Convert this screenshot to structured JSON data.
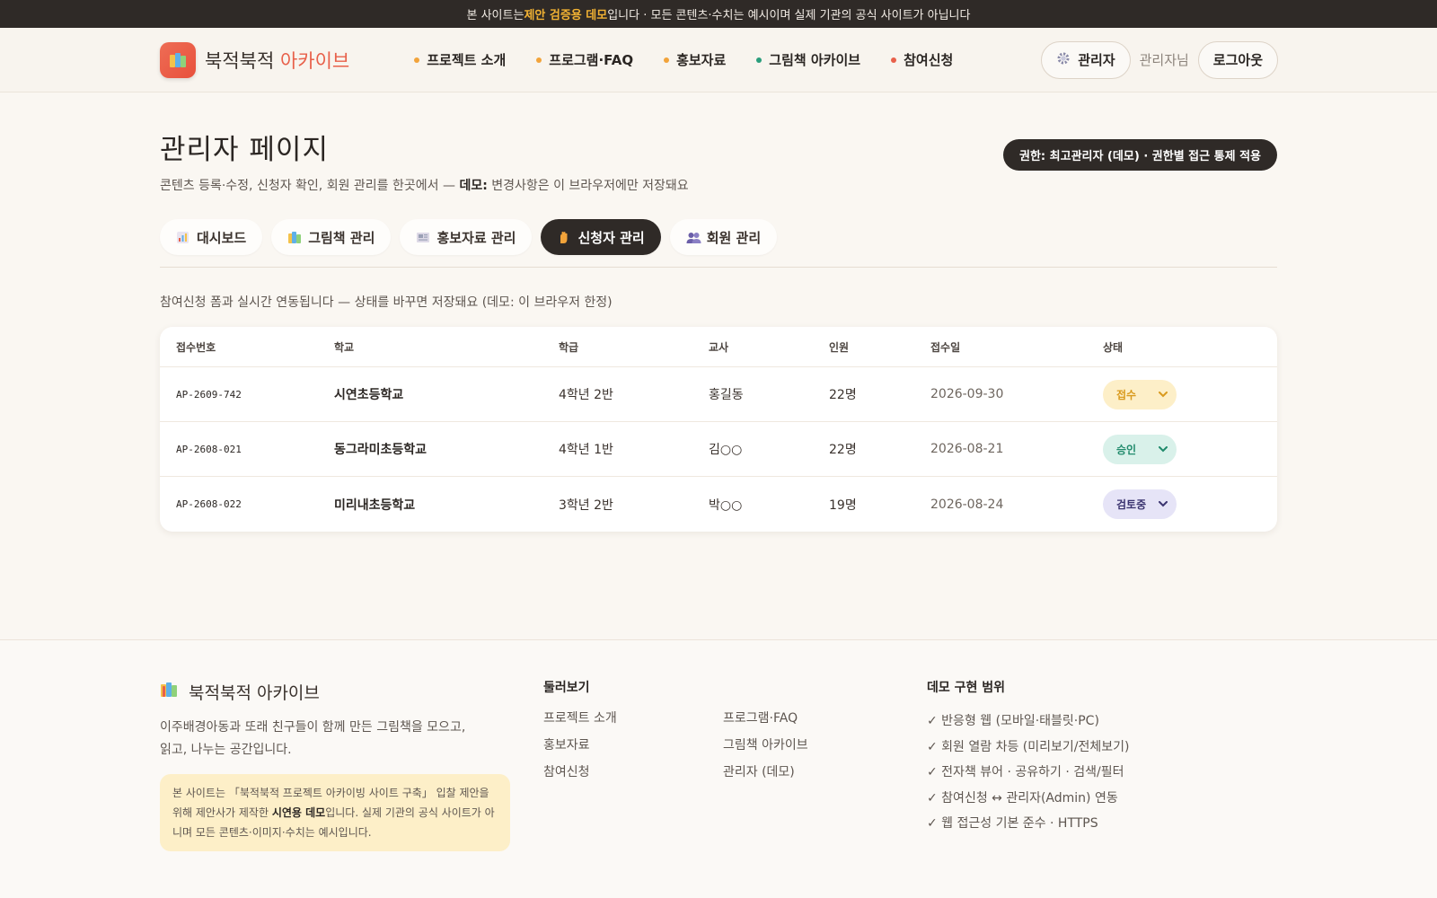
{
  "banner": {
    "pre": "본 사이트는 ",
    "highlight": "제안 검증용 데모",
    "post": "입니다 · 모든 콘텐츠·수치는 예시이며 실제 기관의 공식 사이트가 아닙니다"
  },
  "header": {
    "logo_main": "북적북적",
    "logo_accent": "아카이브",
    "nav": [
      {
        "label": "프로젝트 소개",
        "color": "#f2a33a"
      },
      {
        "label": "프로그램·FAQ",
        "color": "#f2a33a"
      },
      {
        "label": "홍보자료",
        "color": "#f2a33a"
      },
      {
        "label": "그림책 아카이브",
        "color": "#2a9d7c"
      },
      {
        "label": "참여신청",
        "color": "#e8604a"
      }
    ],
    "admin_label": "관리자",
    "user_label": "관리자님",
    "logout_label": "로그아웃"
  },
  "page": {
    "title": "관리자 페이지",
    "subtitle_pre": "콘텐츠 등록·수정, 신청자 확인, 회원 관리를 한곳에서 — ",
    "subtitle_bold": "데모:",
    "subtitle_post": " 변경사항은 이 브라우저에만 저장돼요",
    "permission": "권한: 최고관리자 (데모) · 권한별 접근 통제 적용"
  },
  "tabs": [
    {
      "label": "대시보드",
      "icon": "chart-icon"
    },
    {
      "label": "그림책 관리",
      "icon": "books-icon"
    },
    {
      "label": "홍보자료 관리",
      "icon": "newspaper-icon"
    },
    {
      "label": "신청자 관리",
      "icon": "raised-hand-icon",
      "active": true
    },
    {
      "label": "회원 관리",
      "icon": "people-icon"
    }
  ],
  "applicants": {
    "note": "참여신청 폼과 실시간 연동됩니다 — 상태를 바꾸면 저장돼요 (데모: 이 브라우저 한정)",
    "columns": [
      "접수번호",
      "학교",
      "학급",
      "교사",
      "인원",
      "접수일",
      "상태"
    ],
    "rows": [
      {
        "id": "AP-2609-742",
        "school": "시연초등학교",
        "class": "4학년 2반",
        "teacher": "홍길동",
        "count": "22명",
        "date": "2026-09-30",
        "status": "접수",
        "status_bg": "#fdefc8",
        "status_fg": "#d99a1e"
      },
      {
        "id": "AP-2608-021",
        "school": "동그라미초등학교",
        "class": "4학년 1반",
        "teacher": "김○○",
        "count": "22명",
        "date": "2026-08-21",
        "status": "승인",
        "status_bg": "#d9f1ea",
        "status_fg": "#1f8a6b"
      },
      {
        "id": "AP-2608-022",
        "school": "미리내초등학교",
        "class": "3학년 2반",
        "teacher": "박○○",
        "count": "19명",
        "date": "2026-08-24",
        "status": "검토중",
        "status_bg": "#e6e4f7",
        "status_fg": "#3b3470"
      }
    ]
  },
  "footer": {
    "logo": "북적북적 아카이브",
    "desc_line1": "이주배경아동과 또래 친구들이 함께 만든 그림책을 모으고,",
    "desc_line2": "읽고, 나누는 공간입니다.",
    "notice_pre": "본 사이트는 「북적북적 프로젝트 아카이빙 사이트 구축」 입찰 제안을 위해 제안사가 제작한 ",
    "notice_bold": "시연용 데모",
    "notice_post": "입니다. 실제 기관의 공식 사이트가 아니며 모든 콘텐츠·이미지·수치는 예시입니다.",
    "browse_title": "둘러보기",
    "browse_links": [
      "프로젝트 소개",
      "프로그램·FAQ",
      "홍보자료",
      "그림책 아카이브",
      "참여신청",
      "관리자 (데모)"
    ],
    "scope_title": "데모 구현 범위",
    "scope_items": [
      "✓ 반응형 웹 (모바일·태블릿·PC)",
      "✓ 회원 열람 차등 (미리보기/전체보기)",
      "✓ 전자책 뷰어 · 공유하기 · 검색/필터",
      "✓ 참여신청 ↔ 관리자(Admin) 연동",
      "✓ 웹 접근성 기본 준수 · HTTPS"
    ]
  }
}
